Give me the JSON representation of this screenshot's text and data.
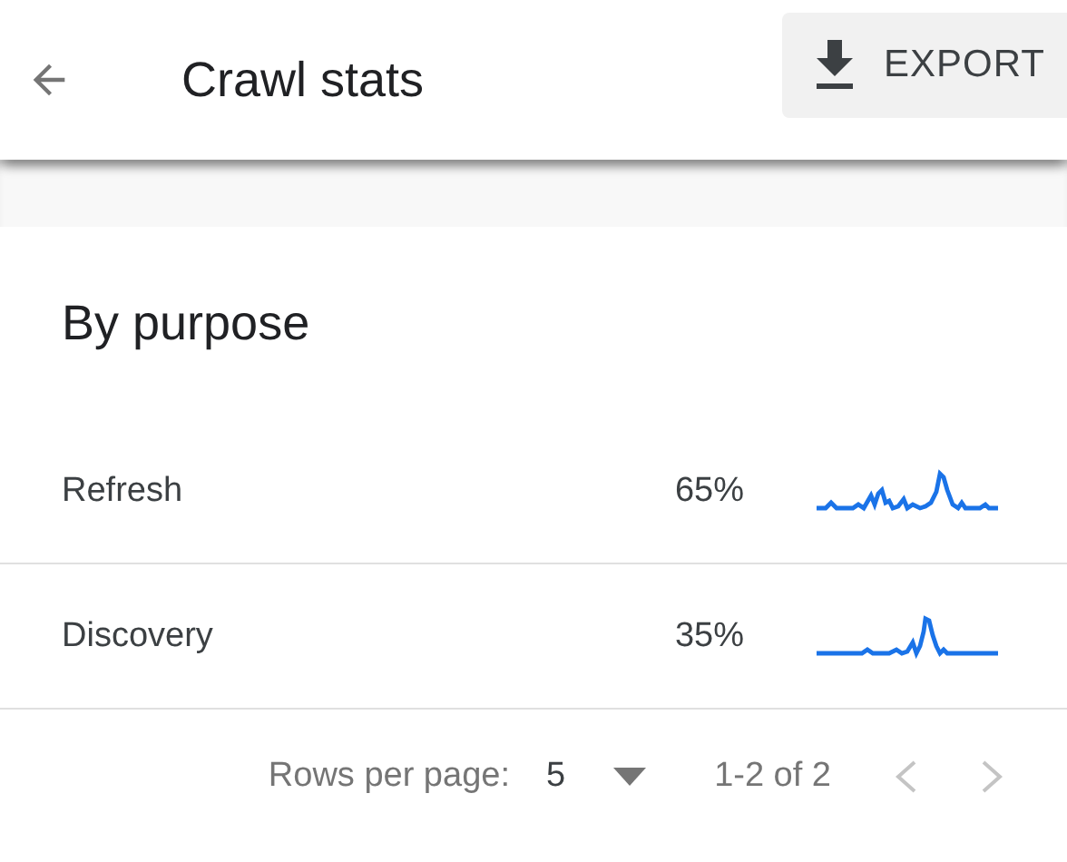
{
  "header": {
    "title": "Crawl stats",
    "export_button": "EXPORT"
  },
  "card": {
    "title": "By purpose",
    "rows": [
      {
        "name": "Refresh",
        "share": "65%"
      },
      {
        "name": "Discovery",
        "share": "35%"
      }
    ],
    "pager": {
      "label": "Rows per page:",
      "rows": "5",
      "range": "1-2 of 2",
      "previous": {
        "disabled": true
      },
      "next": {
        "disabled": true
      }
    }
  }
}
